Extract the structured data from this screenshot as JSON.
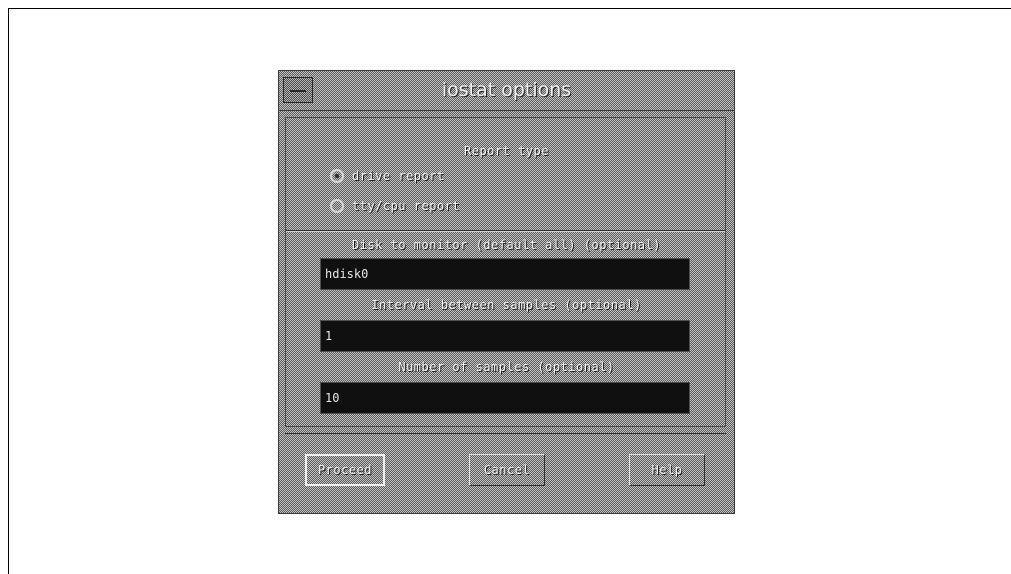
{
  "window": {
    "title": "iostat options"
  },
  "report_type": {
    "label": "Report type",
    "options": [
      {
        "label": "drive report",
        "selected": true
      },
      {
        "label": "tty/cpu report",
        "selected": false
      }
    ]
  },
  "fields": {
    "disk": {
      "label": "Disk to monitor (default all) (optional)",
      "value": "hdisk0"
    },
    "interval": {
      "label": "Interval between samples (optional)",
      "value": "1"
    },
    "samples": {
      "label": "Number of samples (optional)",
      "value": "10"
    }
  },
  "buttons": {
    "proceed": "Proceed",
    "cancel": "Cancel",
    "help": "Help"
  },
  "icons": {
    "window_menu": "window-menu-icon"
  }
}
